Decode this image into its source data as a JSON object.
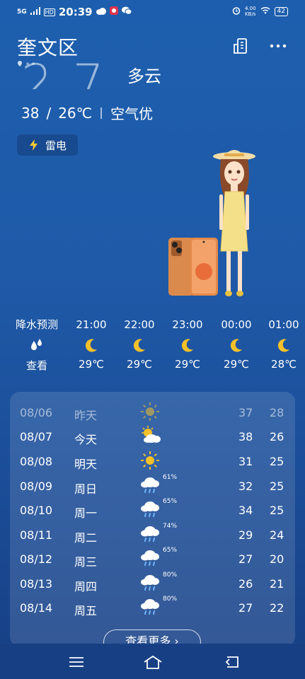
{
  "status_bar": {
    "network": "5G",
    "hd": "HD",
    "time": "20:39",
    "speed": "4.00",
    "speed_unit": "KB/s",
    "battery": "42"
  },
  "header": {
    "location": "奎文区",
    "icons": {
      "city_manage": "building-icon",
      "more": "more-dots-icon"
    }
  },
  "current": {
    "big_temp": "27",
    "condition": "多云",
    "high": "38",
    "slash": "/",
    "low": "26℃",
    "air_quality": "空气优",
    "alert": "雷电"
  },
  "hourly": {
    "label": "降水预测",
    "action": "查看",
    "items": [
      {
        "time": "21:00",
        "temp": "29℃",
        "icon": "moon-icon"
      },
      {
        "time": "22:00",
        "temp": "29℃",
        "icon": "moon-icon"
      },
      {
        "time": "23:00",
        "temp": "29℃",
        "icon": "moon-icon"
      },
      {
        "time": "00:00",
        "temp": "29℃",
        "icon": "moon-icon"
      },
      {
        "time": "01:00",
        "temp": "28℃",
        "icon": "moon-icon"
      }
    ]
  },
  "daily": {
    "rows": [
      {
        "date": "08/06",
        "label": "昨天",
        "icon": "sun-icon",
        "prob": "",
        "high": "37",
        "low": "28",
        "past": true
      },
      {
        "date": "08/07",
        "label": "今天",
        "icon": "partly-cloudy-icon",
        "prob": "",
        "high": "38",
        "low": "26",
        "past": false
      },
      {
        "date": "08/08",
        "label": "明天",
        "icon": "sun-icon",
        "prob": "",
        "high": "31",
        "low": "25",
        "past": false
      },
      {
        "date": "08/09",
        "label": "周日",
        "icon": "rain-cloud-icon",
        "prob": "61%",
        "high": "32",
        "low": "25",
        "past": false
      },
      {
        "date": "08/10",
        "label": "周一",
        "icon": "rain-cloud-icon",
        "prob": "65%",
        "high": "34",
        "low": "25",
        "past": false
      },
      {
        "date": "08/11",
        "label": "周二",
        "icon": "rain-cloud-icon",
        "prob": "74%",
        "high": "29",
        "low": "24",
        "past": false
      },
      {
        "date": "08/12",
        "label": "周三",
        "icon": "rain-cloud-icon",
        "prob": "65%",
        "high": "27",
        "low": "20",
        "past": false
      },
      {
        "date": "08/13",
        "label": "周四",
        "icon": "rain-cloud-icon",
        "prob": "80%",
        "high": "26",
        "low": "21",
        "past": false
      },
      {
        "date": "08/14",
        "label": "周五",
        "icon": "rain-cloud-icon",
        "prob": "80%",
        "high": "27",
        "low": "22",
        "past": false
      }
    ],
    "more_label": "查看更多"
  },
  "colors": {
    "background_top": "#1d5fae",
    "background_bottom": "#173f84",
    "sun": "#f5c02a",
    "lightning": "#ffcc33"
  }
}
